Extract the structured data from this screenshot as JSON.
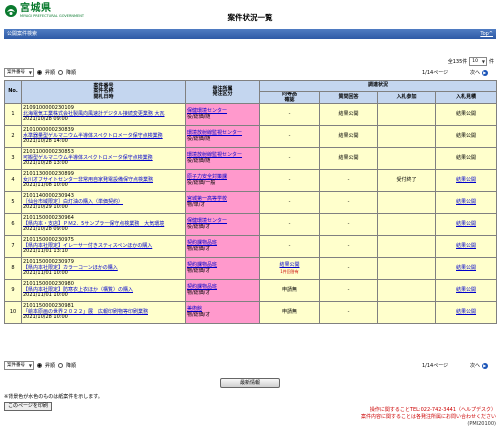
{
  "header": {
    "logo_text": "宮城県",
    "logo_sub": "MIYAGI PREFECTURAL GOVERNMENT",
    "title": "案件状況一覧",
    "page_ref": "(PPI20250)"
  },
  "bluebar": {
    "label": "公開案件検索",
    "top_link": "Top^"
  },
  "pager_top": {
    "total": "全135件",
    "per_page": "10",
    "per_page_suffix": "件",
    "sort_select": "案件番号",
    "asc": "昇順",
    "desc": "降順",
    "page": "1/14ページ",
    "next": "次へ"
  },
  "table": {
    "headers": {
      "no": "No.",
      "case": [
        "案件番号",
        "案件名称",
        "開札日時"
      ],
      "dept": [
        "発注所属",
        "発注区分"
      ],
      "survey": "調達状況",
      "equal": [
        "同等品",
        "確認"
      ],
      "qa": "質問回答",
      "join": "入札参加",
      "result": "入札見積"
    },
    "rows": [
      {
        "no": "1",
        "num": "2109100000230109",
        "name": "北海電気工業株式会社製風向風速計デジタル接続変更業務 大瓦",
        "date": "2021/10/28 09:00",
        "dept": "保健環境センター",
        "kind": "役/総価/随",
        "equal": "-",
        "qa": "結果公開",
        "join": "",
        "result": "結果公開"
      },
      {
        "no": "2",
        "num": "2101000000230839",
        "name": "水準器量型ゲルマニウム半導体スペクトロメータ保守点検業務",
        "date": "2021/10/28 14:00",
        "dept": "環境放射線監視センター",
        "kind": "役/総価/随",
        "equal": "-",
        "qa": "結果公開",
        "join": "",
        "result": "結果公開"
      },
      {
        "no": "3",
        "num": "2101100000230853",
        "name": "可搬型ゲルマニウム半導体スペクトロメータ保守点検業務",
        "date": "2021/10/28 13:00",
        "dept": "環境放射線監視センター",
        "kind": "役/総価/随",
        "equal": "-",
        "qa": "結果公開",
        "join": "",
        "result": "結果公開"
      },
      {
        "no": "4",
        "num": "2101130000230899",
        "name": "女川オフサイトセンター非常用自家発電設備保守点検業務",
        "date": "2021/11/08 10:00",
        "dept": "原子力安全対策課",
        "kind": "役/総価/一般",
        "equal": "-",
        "qa": "-",
        "join": "受付終了",
        "result": "結果公開"
      },
      {
        "no": "5",
        "num": "2101140000230943",
        "name": "［仙台市域限定］白灯油の購入（単価契約）",
        "date": "2021/10/29 10:00",
        "dept": "宮城第一高等学校",
        "kind": "物/単/オ",
        "equal": "-",
        "qa": "-",
        "join": "",
        "result": "結果公開"
      },
      {
        "no": "6",
        "num": "2101150000230964",
        "name": "【県内本・支店】ＰＭ2．5サンプラー保守点検業務　大気環境",
        "date": "2021/10/28 09:00",
        "dept": "保健環境センター",
        "kind": "役/総価/オ",
        "equal": "-",
        "qa": "-",
        "join": "",
        "result": "結果公開"
      },
      {
        "no": "7",
        "num": "2101150000230975",
        "name": "【県内本社限定】イレーサー付きスティスペンほかの購入",
        "date": "2021/11/01 13:10",
        "dept": "契約課物品班",
        "kind": "物/総価/オ",
        "equal": "-",
        "qa": "-",
        "join": "",
        "result": "結果公開"
      },
      {
        "no": "8",
        "num": "2101150000230979",
        "name": "【県内本社限定】カラーコーンほかの購入",
        "date": "2021/11/01 10:00",
        "dept": "契約課物品班",
        "kind": "物/総価/オ",
        "equal": "結果公開",
        "equal_note": "1件回答有",
        "qa": "-",
        "join": "",
        "result": "結果公開"
      },
      {
        "no": "9",
        "num": "2101150000230980",
        "name": "【県内本社限定】防寒衣上衣ほか（構覧）の購入",
        "date": "2021/11/01 10:00",
        "dept": "契約課物品班",
        "kind": "物/総価/オ",
        "equal": "申請無",
        "qa": "-",
        "join": "",
        "result": "結果公開"
      },
      {
        "no": "10",
        "num": "2101150000230981",
        "name": "「絵本原画の世界２０２２」展　広報印刷物等印刷業務",
        "date": "2021/10/28 10:00",
        "dept": "美術館",
        "kind": "物/総価/オ",
        "equal": "申請無",
        "qa": "-",
        "join": "",
        "result": "結果公開"
      }
    ]
  },
  "pager_bottom": {
    "sort_select": "案件番号",
    "asc": "昇順",
    "desc": "降順",
    "page": "1/14ページ",
    "next": "次へ"
  },
  "latest_button": "最新情報",
  "note": "※背景色が水色のものは紙案件を示します。",
  "print_button": "このページを印刷",
  "contact": {
    "line1": "操作に関することTEL:022-742-3441（ヘルプデスク）",
    "line2": "案件内容に関することは各発注所属にお問い合わせください",
    "code": "(PMI20100)"
  },
  "colors": {
    "header_bar": "#2e5aa6",
    "dept_cell": "#ff99cc",
    "row_bg": "#ffffcc",
    "table_head": "#c4d6ef",
    "contact": "#cc0000"
  }
}
